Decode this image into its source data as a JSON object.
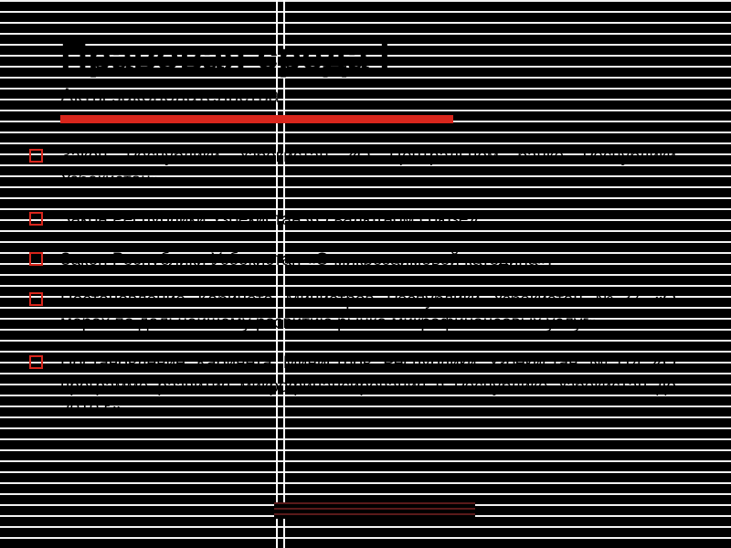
{
  "title": "Правовая среда I",
  "subtitle": "Акты законодательства",
  "items": [
    "Закон Республики Узбекистан «О Центральном банке Республики Узбекистан».",
    "Закон Республики Узбекистан «О валютном союзе».",
    "Закон Республики Узбекистан «О микрозаимовой катедина».",
    "Постановление Кабинета Министров Республики Узбекистан №37 «О мерах по дальнейшему развитию рынка микрофинансовых услуг».",
    "Постановление Кабинета Министров Республики Узбекистан №114 «О программе развития микрофинансирования в Республике Узбекистан до 2010 г.»"
  ]
}
